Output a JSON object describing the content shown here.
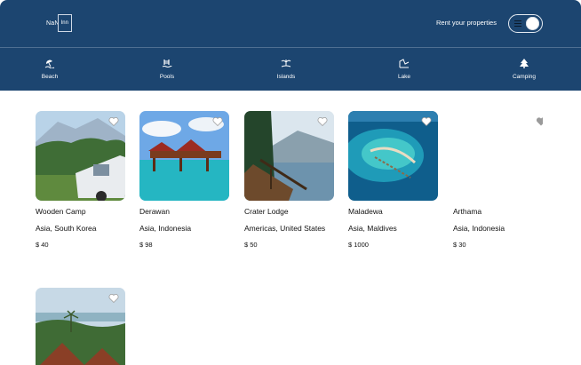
{
  "header": {
    "logo_text": "NaN",
    "logo_suffix": "Inn",
    "rent_label": "Rent your properties",
    "icons": {
      "menu": "menu-icon",
      "avatar": "user-avatar-icon"
    }
  },
  "categories": [
    {
      "label": "Beach",
      "icon": "beach-icon"
    },
    {
      "label": "Pools",
      "icon": "pool-icon"
    },
    {
      "label": "Islands",
      "icon": "island-icon"
    },
    {
      "label": "Lake",
      "icon": "lake-icon"
    },
    {
      "label": "Camping",
      "icon": "camping-icon"
    }
  ],
  "listings": [
    {
      "name": "Wooden Camp",
      "location": "Asia, South Korea",
      "price": "$ 40"
    },
    {
      "name": "Derawan",
      "location": "Asia, Indonesia",
      "price": "$ 98"
    },
    {
      "name": "Crater Lodge",
      "location": "Americas, United States",
      "price": "$ 50"
    },
    {
      "name": "Maladewa",
      "location": "Asia, Maldives",
      "price": "$ 1000"
    },
    {
      "name": "Arthama",
      "location": "Asia, Indonesia",
      "price": "$ 30"
    },
    {
      "name": "",
      "location": "",
      "price": ""
    }
  ],
  "colors": {
    "header_bg": "#1c4570",
    "heart": "#ffffff",
    "heart_empty": "#9a9a9a"
  }
}
